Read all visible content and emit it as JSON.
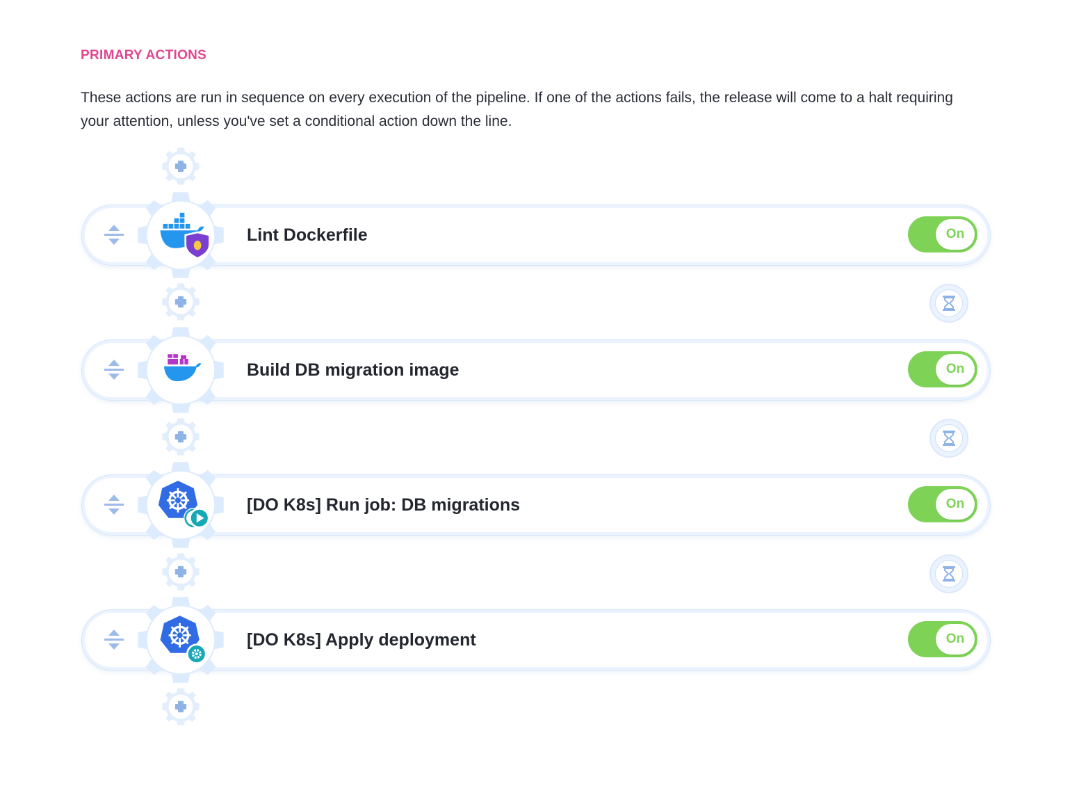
{
  "section": {
    "title": "PRIMARY ACTIONS",
    "description": "These actions are run in sequence on every execution of the pipeline. If one of the actions fails, the release will come to a halt requiring your attention, unless you've set a conditional action down the line."
  },
  "actions": [
    {
      "name": "Lint Dockerfile",
      "icon": "docker-lint-icon",
      "badge": "bug-shield-badge-icon",
      "toggle": "On"
    },
    {
      "name": "Build DB migration image",
      "icon": "docker-build-icon",
      "badge": "",
      "toggle": "On"
    },
    {
      "name": "[DO K8s] Run job: DB migrations",
      "icon": "kubernetes-run-job-icon",
      "badge": "play-badge-icon",
      "toggle": "On"
    },
    {
      "name": "[DO K8s] Apply deployment",
      "icon": "kubernetes-apply-icon",
      "badge": "gear-badge-icon",
      "toggle": "On"
    }
  ],
  "icons": {
    "add": "plus-icon",
    "wait": "hourglass-icon",
    "drag": "drag-handle-icon"
  },
  "colors": {
    "section_title": "#e0468f",
    "toggle_on": "#7ed357",
    "gear_fill": "#dcebfd",
    "docker_blue": "#2496ed",
    "k8s_blue": "#326ce5",
    "plus_blue": "#8fb3e6"
  }
}
